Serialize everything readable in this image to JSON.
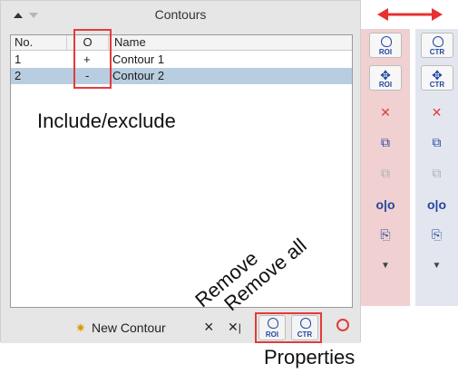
{
  "panel": {
    "title": "Contours",
    "columns": [
      "No.",
      "O",
      "Name"
    ],
    "rows": [
      {
        "no": "1",
        "o": "+",
        "name": "Contour 1",
        "selected": false
      },
      {
        "no": "2",
        "o": "-",
        "name": "Contour 2",
        "selected": true
      }
    ]
  },
  "toolbar": {
    "new_contour": "New Contour",
    "remove_label": "×",
    "remove_all_label": "✕",
    "roi_label": "ROI",
    "ctr_label": "CTR"
  },
  "side": {
    "roi": "ROI",
    "ctr": "CTR"
  },
  "annotations": {
    "include_exclude": "Include/exclude",
    "remove": "Remove",
    "remove_all": "Remove all",
    "properties": "Properties"
  },
  "colors": {
    "selected_row": "#b9cde0",
    "highlight_box": "#e23b3b",
    "arrow": "#e83030",
    "side_pink": "#f0d0d0",
    "side_blue": "#e3e6ee",
    "icon_blue": "#2346a0"
  }
}
